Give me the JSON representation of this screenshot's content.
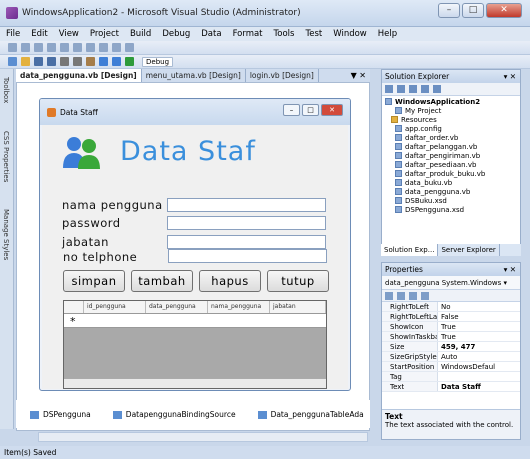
{
  "window": {
    "title": "WindowsApplication2 - Microsoft Visual Studio (Administrator)",
    "min": "–",
    "max": "□",
    "close": "✕"
  },
  "menu": [
    "File",
    "Edit",
    "View",
    "Project",
    "Build",
    "Debug",
    "Data",
    "Format",
    "Tools",
    "Test",
    "Window",
    "Help"
  ],
  "toolbar": {
    "debug_dropdown": "Debug"
  },
  "left_tools": [
    "Toolbox",
    "CSS Properties",
    "Manage Styles"
  ],
  "tabs": [
    "data_pengguna.vb [Design]",
    "menu_utama.vb [Design]",
    "login.vb [Design]"
  ],
  "tabs_pin": "▼ ✕",
  "form": {
    "caption": "Data Staff",
    "heading": "Data Staf",
    "labels": [
      "nama pengguna",
      "password",
      "jabatan",
      "no telphone"
    ],
    "buttons": [
      "simpan",
      "tambah",
      "hapus",
      "tutup"
    ],
    "grid_columns": [
      "id_pengguna",
      "data_pengguna",
      "nama_pengguna",
      "jabatan"
    ],
    "new_row_marker": "*"
  },
  "tray": [
    "DSPengguna",
    "DatapenggunaBindingSource",
    "Data_penggunaTableAda"
  ],
  "status": "Item(s) Saved",
  "solution_explorer": {
    "title": "Solution Explorer",
    "pin": "▾ ✕",
    "items": [
      "WindowsApplication2",
      "My Project",
      "Resources",
      "app.config",
      "daftar_order.vb",
      "daftar_pelanggan.vb",
      "daftar_pengiriman.vb",
      "daftar_pesediaan.vb",
      "daftar_produk_buku.vb",
      "data_buku.vb",
      "data_pengguna.vb",
      "DSBuku.xsd",
      "DSPengguna.xsd"
    ],
    "tabs": [
      "Solution Exp...",
      "Server Explorer"
    ]
  },
  "properties": {
    "title": "Properties",
    "pin": "▾ ✕",
    "object": "data_pengguna System.Windows ▾",
    "rows": [
      {
        "k": "RightToLeft",
        "v": "No"
      },
      {
        "k": "RightToLeftLay",
        "v": "False"
      },
      {
        "k": "ShowIcon",
        "v": "True"
      },
      {
        "k": "ShowInTaskbar",
        "v": "True"
      },
      {
        "k": "Size",
        "v": "459, 477"
      },
      {
        "k": "SizeGripStyle",
        "v": "Auto"
      },
      {
        "k": "StartPosition",
        "v": "WindowsDefaul"
      },
      {
        "k": "Tag",
        "v": ""
      },
      {
        "k": "Text",
        "v": "Data Staff"
      }
    ],
    "desc_title": "Text",
    "desc": "The text associated with the control."
  },
  "colors": {
    "heading": "#3a8fdc",
    "accent": "#5b8ed1"
  }
}
